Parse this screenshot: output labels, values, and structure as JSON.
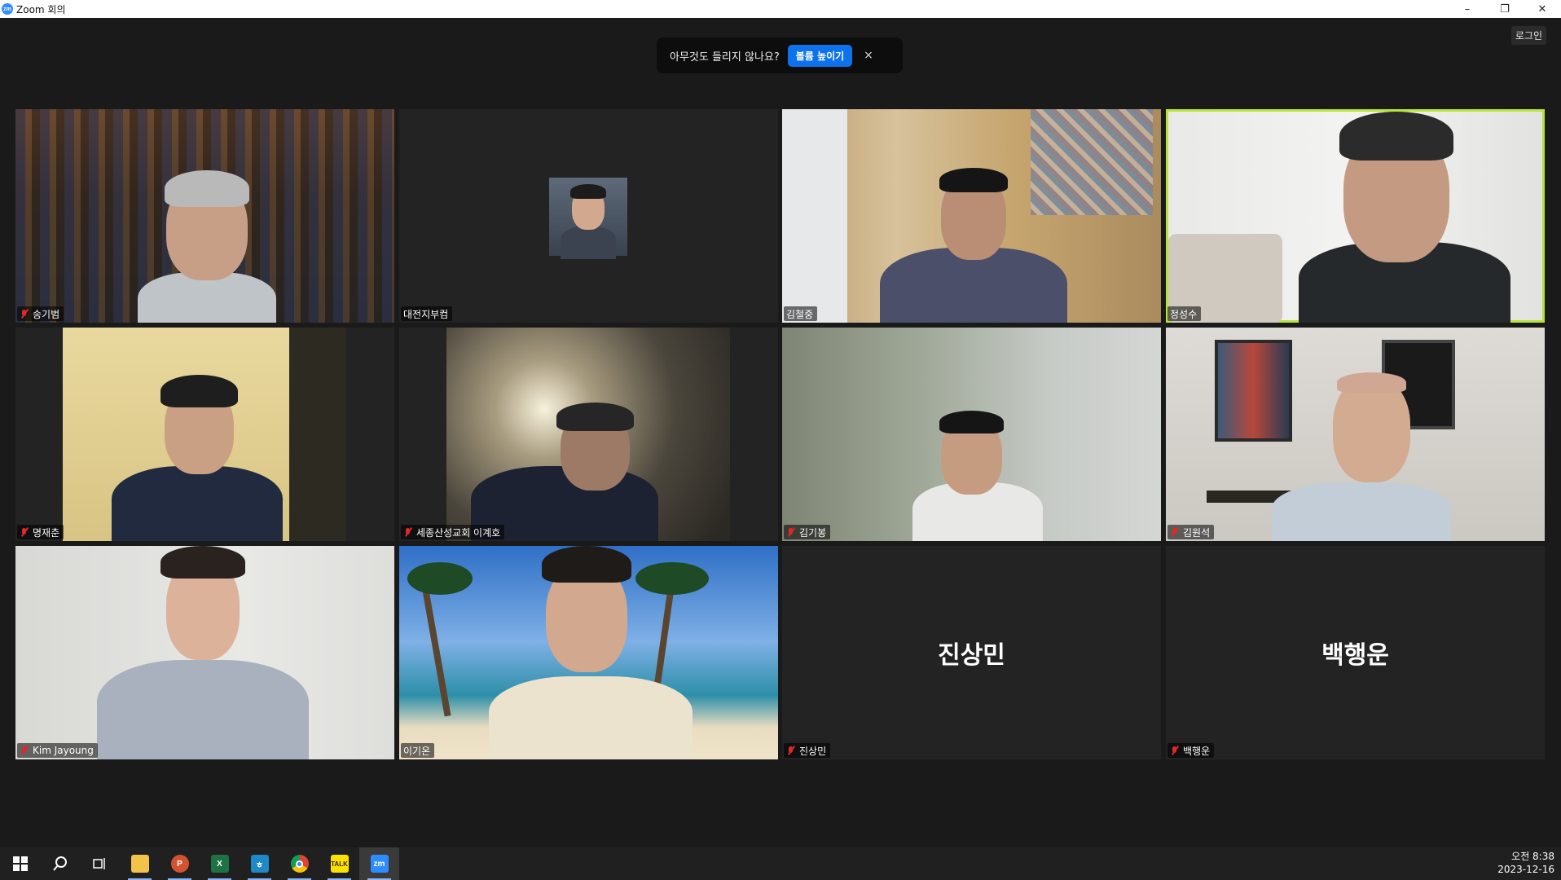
{
  "window": {
    "title": "Zoom 회의",
    "logo": "zm",
    "controls": [
      "–",
      "❐",
      "✕"
    ]
  },
  "header": {
    "login_label": "로그인"
  },
  "notice": {
    "text": "아무것도 들리지 않나요?",
    "button_label": "볼륨 높이기",
    "close": "×"
  },
  "participants": [
    {
      "name": "송기범",
      "muted": true
    },
    {
      "name": "대전지부컴",
      "muted": false
    },
    {
      "name": "김철중",
      "muted": false
    },
    {
      "name": "정성수",
      "muted": false,
      "active_speaker": true
    },
    {
      "name": "명재춘",
      "muted": true
    },
    {
      "name": "세종산성교회 이계호",
      "muted": true
    },
    {
      "name": "김기봉",
      "muted": true
    },
    {
      "name": "김원석",
      "muted": true
    },
    {
      "name": "Kim Jayoung",
      "muted": true
    },
    {
      "name": "이기온",
      "muted": false
    },
    {
      "name": "진상민",
      "muted": true,
      "video_off": true,
      "big_label": "진상민"
    },
    {
      "name": "백행운",
      "muted": true,
      "video_off": true,
      "big_label": "백행운"
    }
  ],
  "taskbar": {
    "items": [
      "windows-start",
      "search",
      "task-view",
      "file-explorer",
      "powerpoint",
      "excel",
      "hangul",
      "chrome",
      "kakaotalk",
      "zoom"
    ],
    "time": "오전 8:38",
    "date": "2023-12-16"
  },
  "colors": {
    "accent": "#0e72ed",
    "active_border": "#b6e43a",
    "mute_red": "#e02828"
  }
}
